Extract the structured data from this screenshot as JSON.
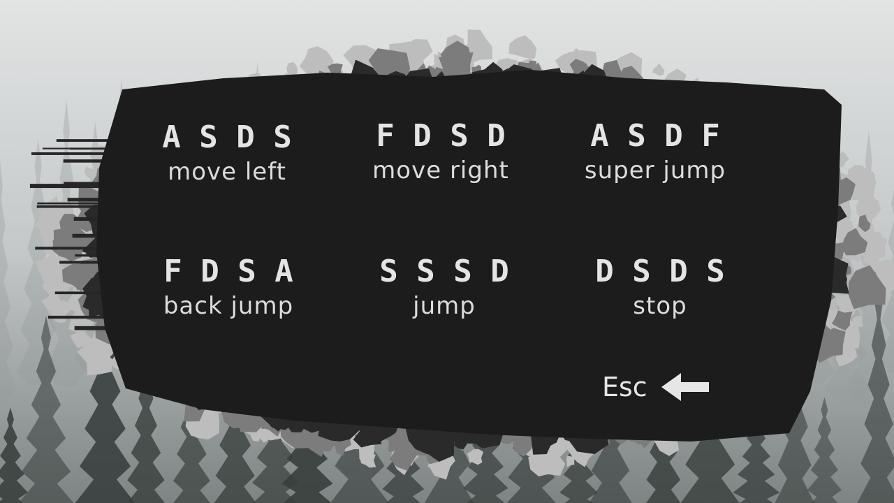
{
  "controls_screen": {
    "combos": [
      {
        "keys": "A S D S",
        "action": "move left"
      },
      {
        "keys": "F D S D",
        "action": "move right"
      },
      {
        "keys": "A S D F",
        "action": "super jump"
      },
      {
        "keys": "F D S A",
        "action": "back jump"
      },
      {
        "keys": "S S S D",
        "action": "jump"
      },
      {
        "keys": "D S D S",
        "action": "stop"
      }
    ],
    "back": {
      "label": "Esc",
      "icon": "left-arrow-icon"
    }
  },
  "colors": {
    "panel": "#1c1c1c",
    "text": "#e4e4e4",
    "fog": "#c9cccc",
    "paint_grey": "#7c7c7c",
    "paint_light": "#bdbdbd"
  }
}
